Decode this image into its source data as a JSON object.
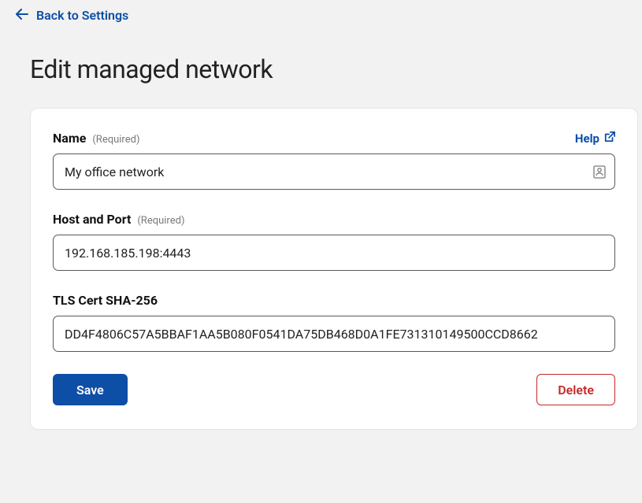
{
  "nav": {
    "back_label": "Back to Settings"
  },
  "page": {
    "title": "Edit managed network"
  },
  "help": {
    "label": "Help"
  },
  "form": {
    "name": {
      "label": "Name",
      "required_text": "(Required)",
      "value": "My office network"
    },
    "host_port": {
      "label": "Host and Port",
      "required_text": "(Required)",
      "value": "192.168.185.198:4443"
    },
    "tls_cert": {
      "label": "TLS Cert SHA-256",
      "value": "DD4F4806C57A5BBAF1AA5B080F0541DA75DB468D0A1FE731310149500CCD8662"
    }
  },
  "buttons": {
    "save": "Save",
    "delete": "Delete"
  }
}
